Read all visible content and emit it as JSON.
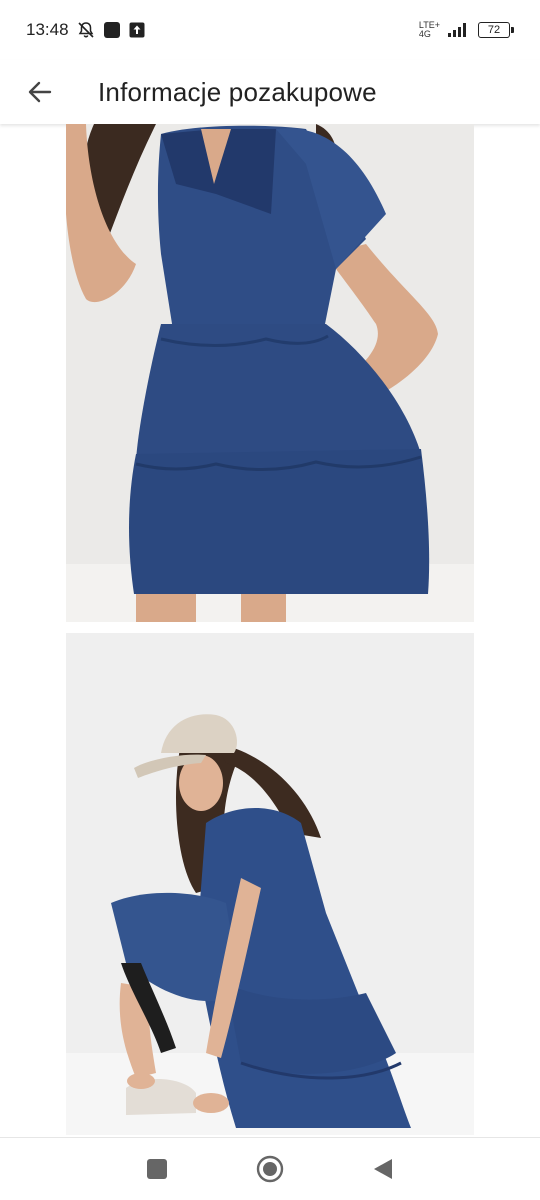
{
  "status_bar": {
    "time": "13:48",
    "network_top": "LTE+",
    "network_bottom": "4G",
    "battery": "72"
  },
  "app_bar": {
    "title": "Informacje pozakupowe",
    "back_icon": "arrow-left-icon"
  },
  "images": [
    {
      "subject": "denim tiered mini dress, torso crop",
      "colors": {
        "dress": "#2f4d86",
        "background": "#ebeae8",
        "skin": "#d9a98a",
        "hair": "#3b2a20"
      }
    },
    {
      "subject": "woman crouching in denim dress with beige cap",
      "colors": {
        "dress": "#2f4f8a",
        "background": "#efefef",
        "cap": "#dcd2c4",
        "shoe": "#e3ddd6"
      }
    }
  ],
  "nav_bar": {
    "recent_icon": "square-icon",
    "home_icon": "circle-home-icon",
    "back_icon": "triangle-back-icon"
  }
}
